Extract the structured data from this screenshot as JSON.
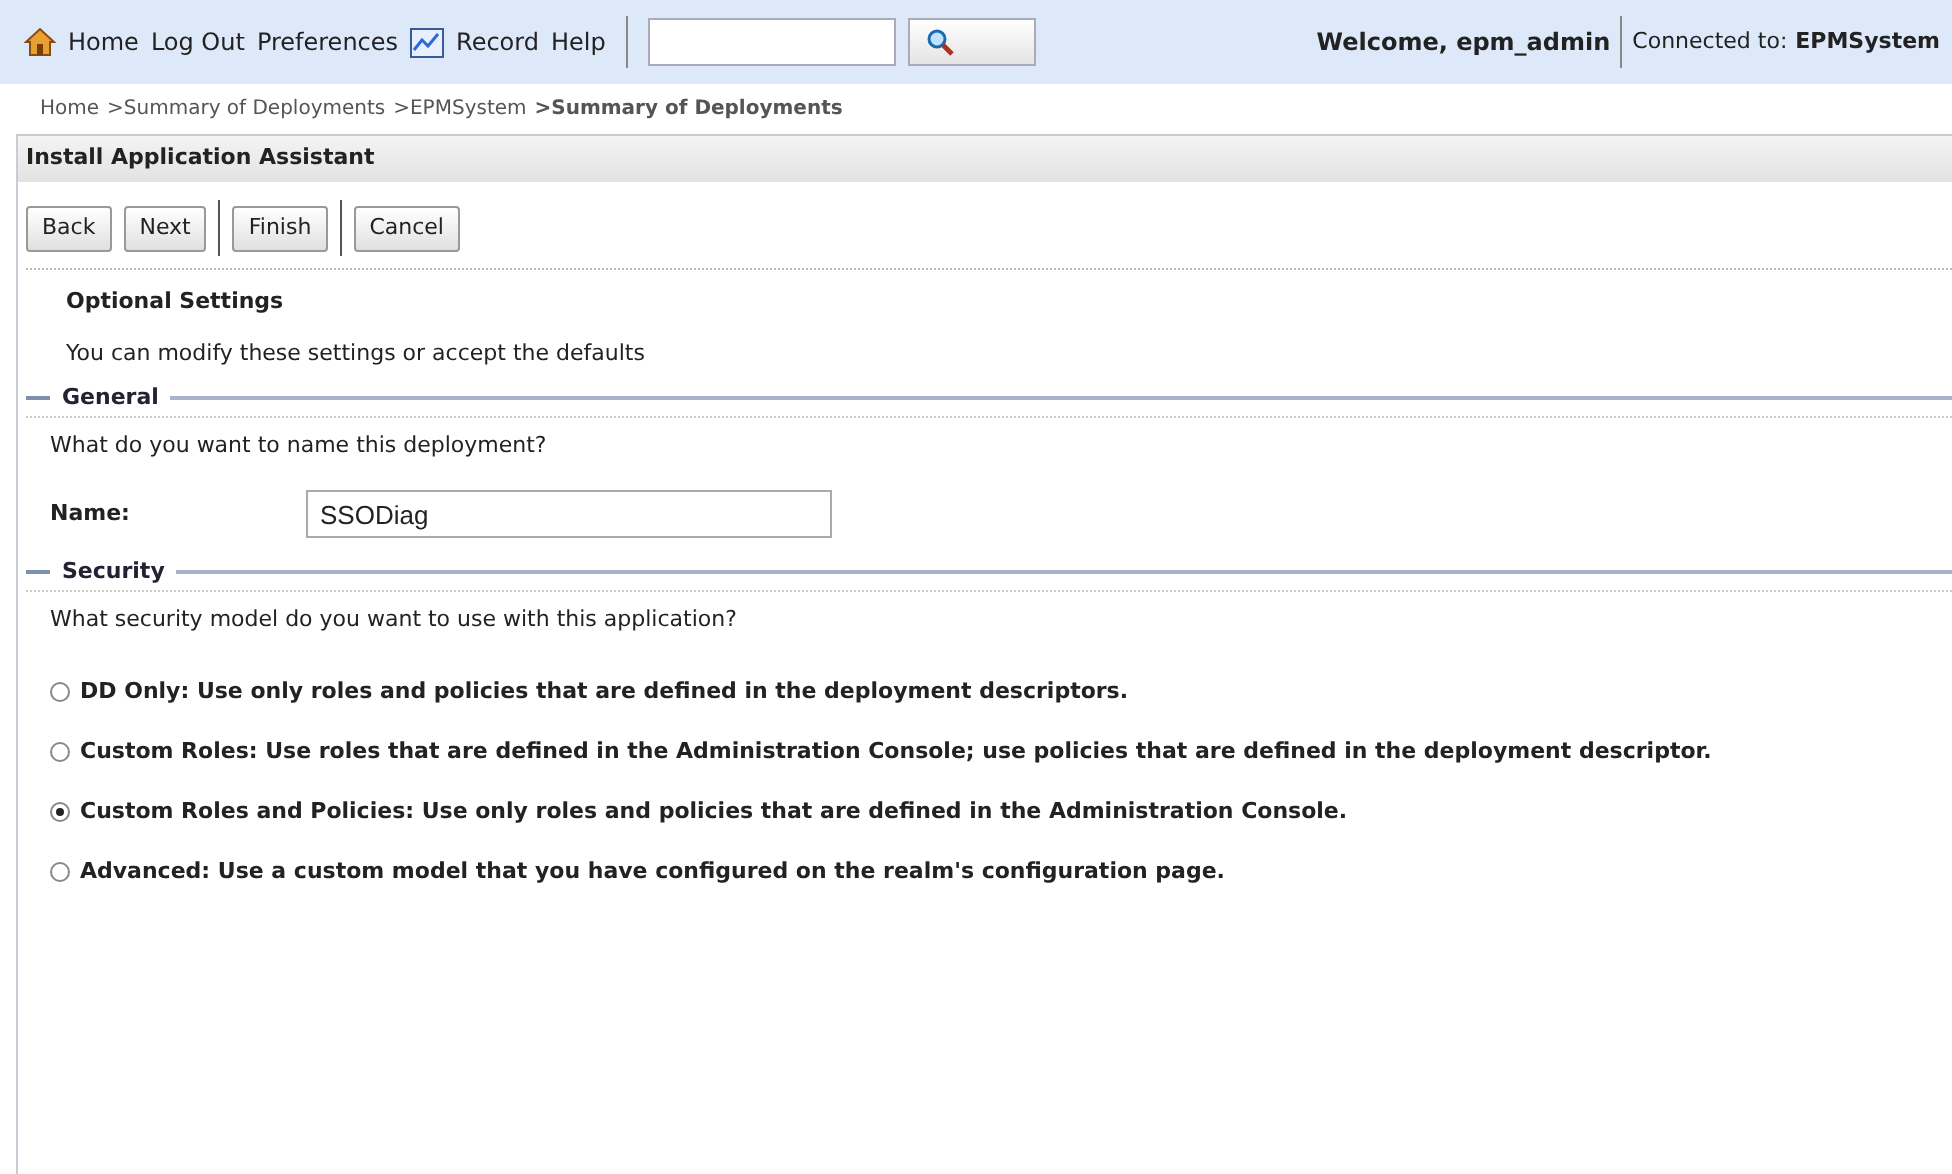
{
  "top_bar": {
    "links": [
      {
        "label": "Home",
        "kind": "home"
      },
      {
        "label": "Log Out",
        "kind": "plain"
      },
      {
        "label": "Preferences",
        "kind": "plain"
      },
      {
        "label": "Record",
        "kind": "record"
      },
      {
        "label": "Help",
        "kind": "plain"
      }
    ],
    "welcome": "Welcome, epm_admin",
    "connected_label": "Connected to:",
    "connected_value": "EPMSystem"
  },
  "breadcrumb": {
    "items": [
      "Home",
      ">Summary of Deployments",
      ">EPMSystem"
    ],
    "current": ">Summary of Deployments"
  },
  "panel_title": "Install Application Assistant",
  "buttons": [
    {
      "label": "Back"
    },
    {
      "label": "Next"
    },
    {
      "label": "Finish"
    },
    {
      "label": "Cancel"
    }
  ],
  "heading": "Optional Settings",
  "intro": "You can modify these settings or accept the defaults",
  "general": {
    "legend": "General",
    "question": "What do you want to name this deployment?",
    "name_label": "Name:",
    "name_value": "SSODiag"
  },
  "security": {
    "legend": "Security",
    "question": "What security model do you want to use with this application?",
    "options": [
      {
        "label": "DD Only: Use only roles and policies that are defined in the deployment descriptors.",
        "selected": false
      },
      {
        "label": "Custom Roles: Use roles that are defined in the Administration Console; use policies that are defined in the deployment descriptor.",
        "selected": false
      },
      {
        "label": "Custom Roles and Policies: Use only roles and policies that are defined in the Administration Console.",
        "selected": true
      },
      {
        "label": "Advanced: Use a custom model that you have configured on the realm's configuration page.",
        "selected": false
      }
    ]
  }
}
